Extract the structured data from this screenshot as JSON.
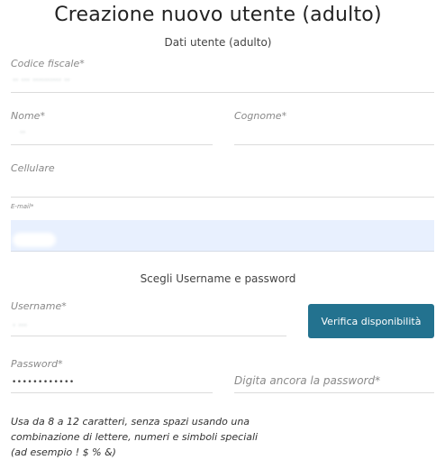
{
  "page": {
    "title": "Creazione nuovo utente (adulto)",
    "subtitle": "Dati utente (adulto)"
  },
  "fields": {
    "codice_fiscale": {
      "label": "Codice fiscale*",
      "value": "·· ··· ·········· ··"
    },
    "nome": {
      "label": "Nome*",
      "value": "··"
    },
    "cognome": {
      "label": "Cognome*",
      "value": ""
    },
    "cellulare": {
      "label": "Cellulare",
      "value": ""
    },
    "email": {
      "label": "E-mail*",
      "value": ""
    }
  },
  "credentials": {
    "section_title": "Scegli Username e password",
    "username": {
      "label": "Username*",
      "value": "· ···"
    },
    "check_button": "Verifica disponibilità",
    "password": {
      "label": "Password*",
      "value": "••••••••••••"
    },
    "password_confirm": {
      "placeholder": "Digita ancora la password*"
    }
  },
  "help_lines": [
    "Usa da 8 a 12 caratteri, senza spazi usando una",
    "combinazione di lettere, numeri e simboli speciali",
    "(ad esempio ! $ % &)"
  ],
  "colors": {
    "primary_button": "#23728f",
    "autofill_background": "#e8f0fe"
  }
}
